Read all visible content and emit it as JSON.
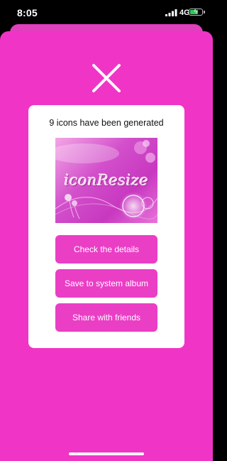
{
  "status_bar": {
    "time": "8:05",
    "network": "4G",
    "icons": [
      "signal-icon",
      "battery-icon"
    ],
    "battery_level": 0.8,
    "battery_color": "#34c759"
  },
  "modal": {
    "close_icon": "close-icon",
    "background_color": "#f034c6",
    "title": "9 icons have been generated",
    "preview": {
      "watermark_text": "iconResize"
    },
    "buttons": {
      "check_details": "Check the details",
      "save_album": "Save to system album",
      "share_friends": "Share with friends"
    },
    "button_color": "#ea3ec5"
  }
}
